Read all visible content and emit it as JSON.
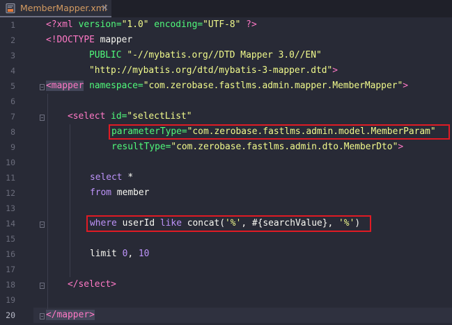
{
  "tab": {
    "filename": "MemberMapper.xml",
    "close": "×"
  },
  "editor": {
    "line_numbers": [
      "1",
      "2",
      "3",
      "4",
      "5",
      "6",
      "7",
      "8",
      "9",
      "10",
      "11",
      "12",
      "13",
      "14",
      "15",
      "16",
      "17",
      "18",
      "19",
      "20"
    ],
    "current_line": "20",
    "lines": {
      "l1": {
        "a": "<?xml",
        "b": " version=",
        "c": "\"1.0\"",
        "d": " encoding=",
        "e": "\"UTF-8\"",
        "f": " ?>"
      },
      "l2": {
        "a": "<!DOCTYPE",
        "b": " mapper"
      },
      "l3": {
        "a": "PUBLIC ",
        "b": "\"-//mybatis.org//DTD Mapper 3.0//EN\""
      },
      "l4": {
        "a": "\"http://mybatis.org/dtd/mybatis-3-mapper.dtd\"",
        "b": ">"
      },
      "l5": {
        "a": "<mapper",
        "b": " namespace=",
        "c": "\"com.zerobase.fastlms.admin.mapper.MemberMapper\"",
        "d": ">"
      },
      "l7": {
        "a": "<select",
        "b": " id=",
        "c": "\"selectList\""
      },
      "l8": {
        "a": "parameterType=",
        "b": "\"com.zerobase.fastlms.admin.model.MemberParam\""
      },
      "l9": {
        "a": "resultType=",
        "b": "\"com.zerobase.fastlms.admin.dto.MemberDto\"",
        "c": ">"
      },
      "l11": {
        "a": "select",
        "b": " *"
      },
      "l12": {
        "a": "from",
        "b": " member"
      },
      "l14": {
        "a": "where",
        "b": " userId ",
        "c": "like",
        "d": " concat(",
        "e": "'%'",
        "f": ", #{searchValue}, ",
        "g": "'%'",
        "h": ")"
      },
      "l16": {
        "a": "limit ",
        "b": "0",
        "c": ", ",
        "d": "10"
      },
      "l18": {
        "a": "</select",
        "b": ">"
      },
      "l20": {
        "a": "</mapper",
        "b": ">"
      }
    }
  },
  "colors": {
    "background": "#282a36",
    "highlight_box": "#e01b24",
    "tab_text": "#d49b61"
  }
}
